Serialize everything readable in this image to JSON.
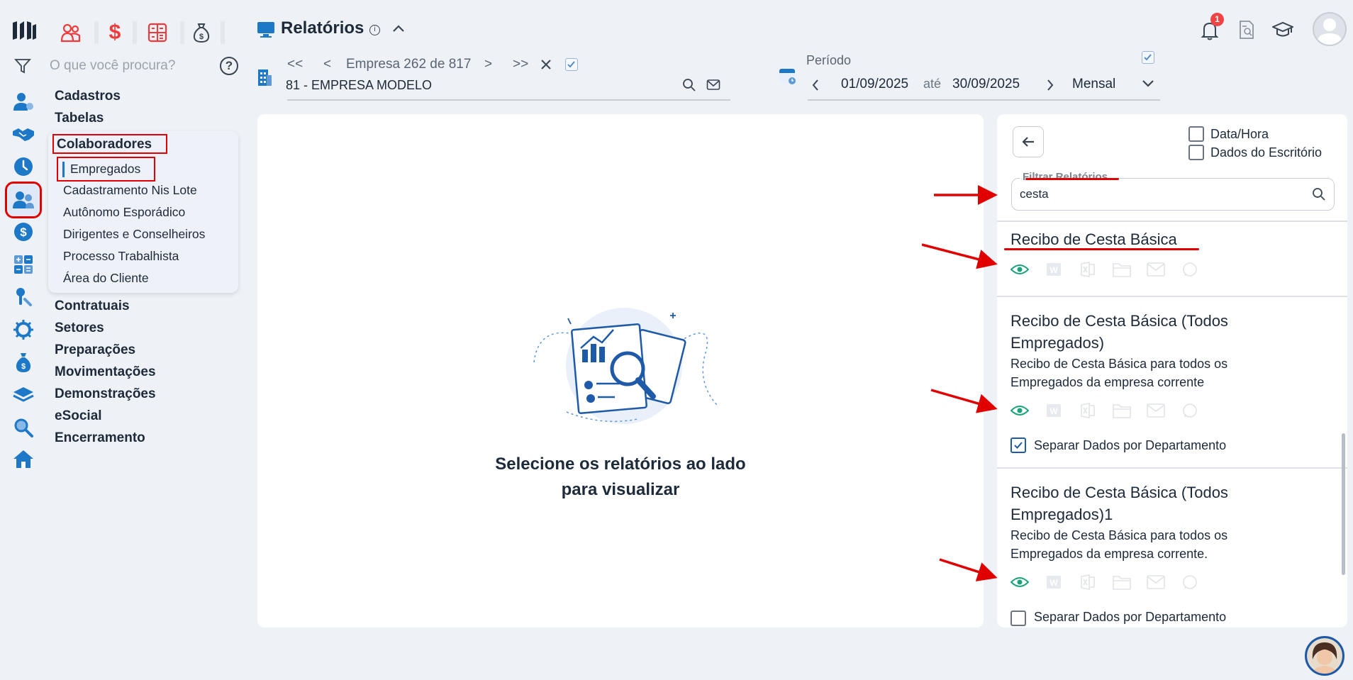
{
  "header": {
    "title": "Relatórios",
    "empresa_nav": {
      "first": "<<",
      "prev": "<",
      "label": "Empresa 262 de 817",
      "next": ">",
      "last": ">>"
    },
    "empresa_name": "81 - EMPRESA MODELO",
    "periodo_label": "Período",
    "date_from": "01/09/2025",
    "ate": "até",
    "date_to": "30/09/2025",
    "freq": "Mensal",
    "notification_count": "1"
  },
  "nav": {
    "search_placeholder": "O que você procura?",
    "help": "?",
    "items_top": [
      "Cadastros",
      "Tabelas"
    ],
    "active_group": "Colaboradores",
    "sub_items": [
      "Empregados",
      "Cadastramento Nis Lote",
      "Autônomo Esporádico",
      "Dirigentes e Conselheiros",
      "Processo Trabalhista",
      "Área do Cliente"
    ],
    "items_bottom": [
      "Contratuais",
      "Setores",
      "Preparações",
      "Movimentações",
      "Demonstrações",
      "eSocial",
      "Encerramento"
    ]
  },
  "main": {
    "empty_line1": "Selecione os relatórios ao lado",
    "empty_line2": "para visualizar"
  },
  "reports_panel": {
    "opt_datahora": "Data/Hora",
    "opt_escritorio": "Dados do Escritório",
    "filter_label": "Filtrar Relatórios",
    "filter_value": "cesta",
    "reports": [
      {
        "title": "Recibo de Cesta Básica"
      },
      {
        "title_l1": "Recibo de Cesta Básica (Todos",
        "title_l2": "Empregados)",
        "desc_l1": "Recibo de Cesta Básica para todos os",
        "desc_l2": "Empregados da empresa corrente",
        "option": "Separar Dados por Departamento"
      },
      {
        "title_l1": "Recibo de Cesta Básica (Todos",
        "title_l2": "Empregados)1",
        "desc_l1": "Recibo de Cesta Básica para todos os",
        "desc_l2": "Empregados da empresa corrente.",
        "option": "Separar Dados por Departamento"
      }
    ]
  },
  "colors": {
    "accent": "#1e5aa8",
    "annotation_red": "#e00000",
    "eye_green": "#1aa37a",
    "module_red": "#ef3b3b"
  }
}
